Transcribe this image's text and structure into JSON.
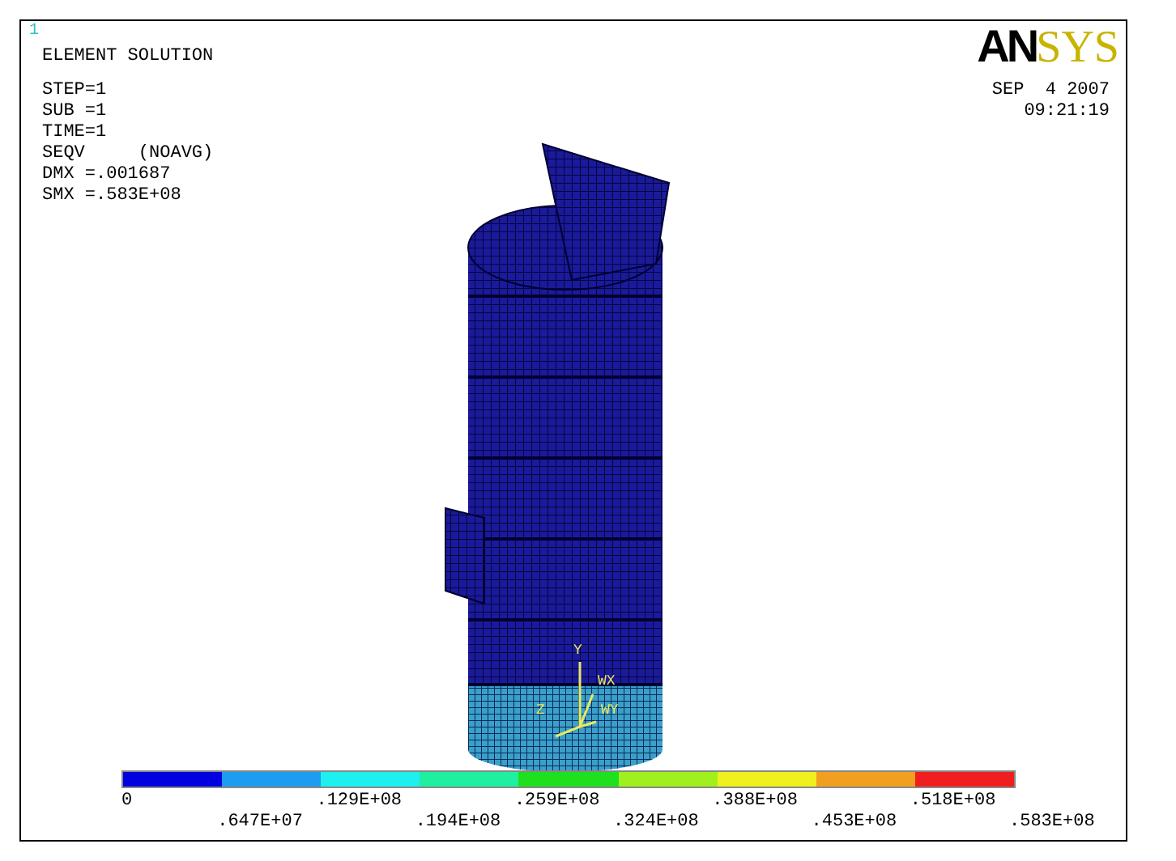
{
  "window_number": "1",
  "title": "ELEMENT SOLUTION",
  "info_lines": [
    "STEP=1",
    "SUB =1",
    "TIME=1",
    "SEQV     (NOAVG)",
    "DMX =.001687",
    "SMX =.583E+08"
  ],
  "logo": {
    "dark_part": "AN",
    "light_part": "SYS"
  },
  "date": "SEP  4 2007",
  "time": "09:21:19",
  "triad_labels": [
    "Y",
    "WX",
    "Z",
    "WY"
  ],
  "legend": {
    "colors": [
      {
        "color": "#0000e0"
      },
      {
        "color": "#1e9cf0"
      },
      {
        "color": "#1ef0f0"
      },
      {
        "color": "#1ef0a0"
      },
      {
        "color": "#1ee01e"
      },
      {
        "color": "#a0f01e"
      },
      {
        "color": "#f0f01e"
      },
      {
        "color": "#f0a01e"
      },
      {
        "color": "#f01e1e"
      }
    ],
    "labels": [
      "0",
      ".647E+07",
      ".129E+08",
      ".194E+08",
      ".259E+08",
      ".324E+08",
      ".388E+08",
      ".453E+08",
      ".518E+08",
      ".583E+08"
    ]
  }
}
